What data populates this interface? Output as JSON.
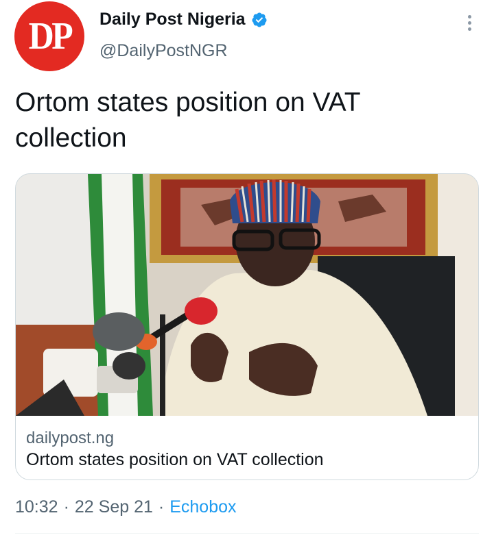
{
  "author": {
    "avatar_text": "DP",
    "display_name": "Daily Post Nigeria",
    "handle": "@DailyPostNGR",
    "verified_icon": "verified-badge-icon",
    "avatar_color": "#e32a22"
  },
  "tweet": {
    "text": "Ortom states position on VAT collection"
  },
  "card": {
    "domain": "dailypost.ng",
    "title": "Ortom states position on VAT collection"
  },
  "meta": {
    "time": "10:32",
    "separator": "·",
    "date": "22 Sep 21",
    "source": "Echobox"
  },
  "colors": {
    "link": "#1d9bf0",
    "secondary": "#536471",
    "border": "#cfd9de"
  }
}
